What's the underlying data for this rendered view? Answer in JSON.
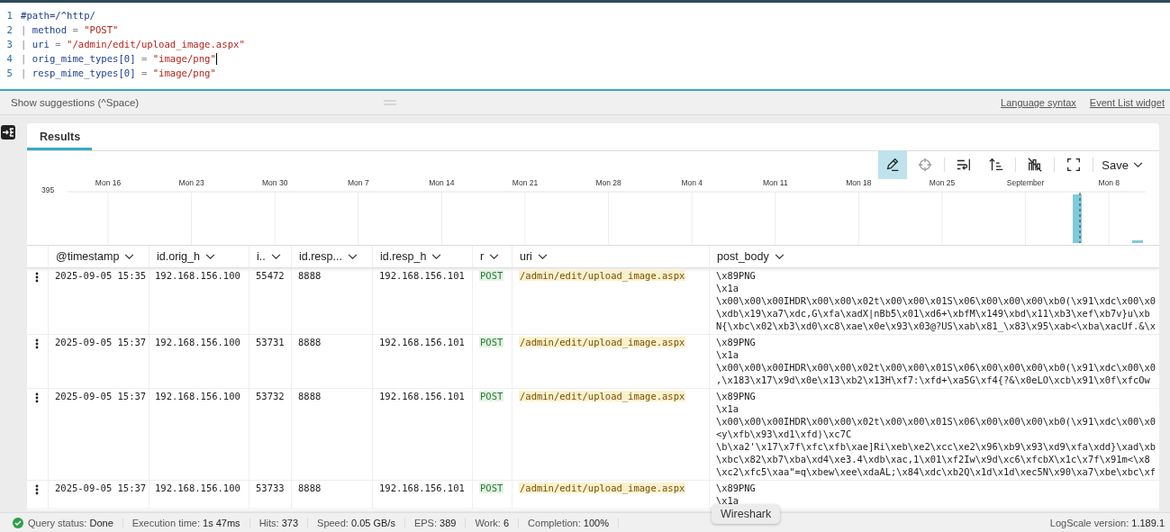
{
  "editor": {
    "lines": [
      {
        "number": "1",
        "cursor": false,
        "tokens": [
          {
            "kind": "keyword",
            "text": "#path=/^http/"
          }
        ]
      },
      {
        "number": "2",
        "cursor": false,
        "tokens": [
          {
            "kind": "pipe",
            "text": "| "
          },
          {
            "kind": "field",
            "text": "method"
          },
          {
            "kind": "op",
            "text": " = "
          },
          {
            "kind": "string",
            "text": "\"POST\""
          }
        ]
      },
      {
        "number": "3",
        "cursor": false,
        "tokens": [
          {
            "kind": "pipe",
            "text": "| "
          },
          {
            "kind": "field",
            "text": "uri"
          },
          {
            "kind": "op",
            "text": " = "
          },
          {
            "kind": "string",
            "text": "\"/admin/edit/upload_image.aspx\""
          }
        ]
      },
      {
        "number": "4",
        "cursor": true,
        "tokens": [
          {
            "kind": "pipe",
            "text": "| "
          },
          {
            "kind": "field",
            "text": "orig_mime_types[0]"
          },
          {
            "kind": "op",
            "text": " = "
          },
          {
            "kind": "string",
            "text": "\"image/png\""
          }
        ]
      },
      {
        "number": "5",
        "cursor": false,
        "tokens": [
          {
            "kind": "pipe",
            "text": "| "
          },
          {
            "kind": "field",
            "text": "resp_mime_types[0]"
          },
          {
            "kind": "op",
            "text": " = "
          },
          {
            "kind": "string",
            "text": "\"image/png\""
          }
        ]
      }
    ]
  },
  "suggestions": {
    "hint": "Show suggestions (^Space)",
    "links": [
      "Language syntax",
      "Event List widget"
    ]
  },
  "tabs": [
    {
      "label": "Results",
      "selected": true
    }
  ],
  "toolbar": {
    "tools": [
      {
        "kind": "pencil",
        "selected": true
      },
      {
        "kind": "crosshair",
        "selected": false
      },
      {
        "kind": "wrap",
        "selected": false
      },
      {
        "kind": "sort",
        "selected": false
      },
      {
        "kind": "chart-off",
        "selected": false
      },
      {
        "kind": "fullscreen",
        "selected": false
      }
    ],
    "save": "Save"
  },
  "histogram": {
    "y_label": "395",
    "x_labels": [
      "Mon 16",
      "Mon 23",
      "Mon 30",
      "Mon 7",
      "Mon 14",
      "Mon 21",
      "Mon 28",
      "Mon 4",
      "Mon 11",
      "Mon 18",
      "Mon 25",
      "September",
      "Mon 8"
    ]
  },
  "table": {
    "columns": [
      {
        "label": "@timestamp",
        "kind": "text"
      },
      {
        "label": "id.orig_h",
        "kind": "text"
      },
      {
        "label": "i..",
        "kind": "text"
      },
      {
        "label": "id.resp...",
        "kind": "text"
      },
      {
        "label": "id.resp_h",
        "kind": "text"
      },
      {
        "label": "r",
        "kind": "method"
      },
      {
        "label": "uri",
        "kind": "uri"
      },
      {
        "label": "post_body",
        "kind": "body"
      }
    ],
    "rows": [
      {
        "cells": [
          "2025-09-05 15:35",
          "192.168.156.100",
          "55472",
          "8888",
          "192.168.156.101",
          "POST",
          "/admin/edit/upload_image.aspx",
          [
            "\\x89PNG",
            "\\x1a",
            "\\x00\\x00\\x00IHDR\\x00\\x00\\x02t\\x00\\x00\\x01S\\x06\\x00\\x00\\x00\\xb0(\\x91\\xdc\\x00\\x0",
            "\\xdb\\x19\\xa7\\xdc,G\\xfa\\xadX|nBb5\\x01\\xd6+\\xbfM\\x149\\xbd\\x11\\xb3\\xef\\xb7v}u\\xb",
            "N{\\xbc\\x02\\xb3\\xd0\\xc8\\xae\\x0e\\x93\\x03@?US\\xab\\x81_\\x83\\x95\\xab<\\xba\\xacUf.&\\x"
          ]
        ]
      },
      {
        "cells": [
          "2025-09-05 15:37",
          "192.168.156.100",
          "53731",
          "8888",
          "192.168.156.101",
          "POST",
          "/admin/edit/upload_image.aspx",
          [
            "\\x89PNG",
            "\\x1a",
            "\\x00\\x00\\x00IHDR\\x00\\x00\\x02t\\x00\\x00\\x01S\\x06\\x00\\x00\\x00\\xb0(\\x91\\xdc\\x00\\x0",
            ",\\x183\\x17\\x9d\\x0e\\x13\\xb2\\x13H\\xf7:\\xfd+\\xa5G\\xf4{?&\\x0eLO\\xcb\\x91\\x0f\\xfcOw"
          ]
        ]
      },
      {
        "cells": [
          "2025-09-05 15:37",
          "192.168.156.100",
          "53732",
          "8888",
          "192.168.156.101",
          "POST",
          "/admin/edit/upload_image.aspx",
          [
            "\\x89PNG",
            "\\x1a",
            "\\x00\\x00\\x00IHDR\\x00\\x00\\x02t\\x00\\x00\\x01S\\x06\\x00\\x00\\x00\\xb0(\\x91\\xdc\\x00\\x0",
            "<y\\xfb\\x93\\xd1\\xfd)\\xc7C",
            "\\b\\xa2'\\x17\\x7f\\xfc\\xfb\\xae]Ri\\xeb\\xe2\\xcc\\xe2\\x96\\xb9\\x93\\xd9\\xfa\\xdd}\\xad\\xb",
            "\\xbc\\x82\\xb7\\xba\\xd4\\xe3.4\\xdb\\xac,1\\x01\\xf2Iw\\x9d\\xc6\\xfcbX\\x1c\\x7f\\x91m<\\x8",
            "\\xc2\\xfc5\\xaa\"=q\\xbew\\xee\\xdaAL;\\x84\\xdc\\xb2Q\\x1d\\x1d\\xec5N\\x90\\xa7\\xbe\\xbc\\xf"
          ]
        ]
      },
      {
        "cells": [
          "2025-09-05 15:37",
          "192.168.156.100",
          "53733",
          "8888",
          "192.168.156.101",
          "POST",
          "/admin/edit/upload_image.aspx",
          [
            "\\x89PNG",
            "\\x1a"
          ]
        ]
      }
    ]
  },
  "status_bar": {
    "items": [
      {
        "label": "Query status:",
        "value": "Done"
      },
      {
        "label": "Execution time:",
        "value": "1s 47ms"
      },
      {
        "label": "Hits:",
        "value": "373"
      },
      {
        "label": "Speed:",
        "value": "0.05 GB/s"
      },
      {
        "label": "EPS:",
        "value": "389"
      },
      {
        "label": "Work:",
        "value": "6"
      },
      {
        "label": "Completion:",
        "value": "100%"
      }
    ],
    "version_label": "LogScale version:",
    "version": "1.189.1"
  },
  "tooltip": "Wireshark"
}
